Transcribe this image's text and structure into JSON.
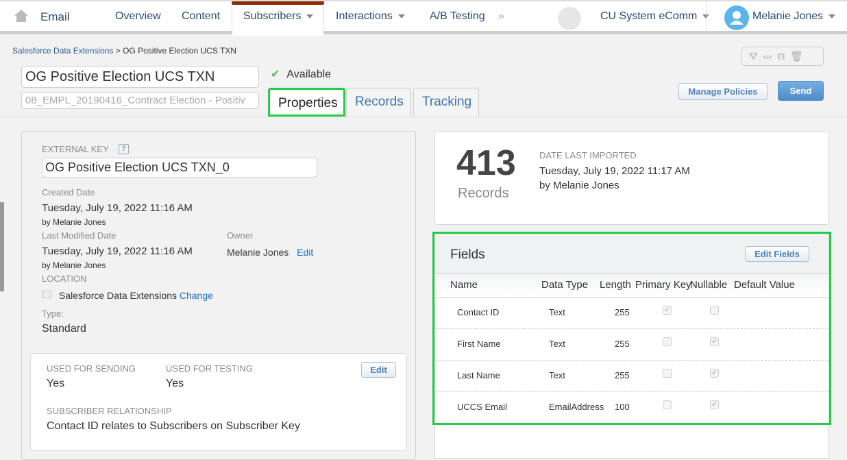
{
  "nav": {
    "home_icon": "home-icon",
    "app": "Email",
    "items": [
      "Overview",
      "Content",
      "Subscribers",
      "Interactions",
      "A/B Testing"
    ],
    "more": "»",
    "business_unit": "CU System eComm",
    "user": "Melanie Jones"
  },
  "breadcrumb": {
    "root": "Salesforce Data Extensions",
    "sep": ">",
    "current": "OG Positive Election UCS TXN"
  },
  "header": {
    "name": "OG Positive Election UCS TXN",
    "description": "08_EMPL_20190416_Contract Election - Positiv",
    "status": "Available",
    "tabs": [
      "Properties",
      "Records",
      "Tracking"
    ],
    "active_tab": "Properties",
    "manage_policies": "Manage Policies",
    "send": "Send",
    "tool_icons": [
      "filter-icon",
      "compare-icon",
      "copy-icon",
      "trash-icon"
    ]
  },
  "properties": {
    "external_key_label": "EXTERNAL KEY",
    "help": "?",
    "external_key": "OG Positive Election UCS TXN_0",
    "created_label": "Created Date",
    "created": "Tuesday, July 19, 2022 11:16 AM",
    "created_by": "by Melanie Jones",
    "modified_label": "Last Modified Date",
    "modified": "Tuesday, July 19, 2022 11:16 AM",
    "modified_by": "by Melanie Jones",
    "owner_label": "Owner",
    "owner": "Melanie Jones",
    "owner_edit": "Edit",
    "location_label": "LOCATION",
    "location": "Salesforce Data Extensions",
    "location_change": "Change",
    "type_label": "Type:",
    "type": "Standard"
  },
  "usage": {
    "sending_label": "USED FOR SENDING",
    "sending": "Yes",
    "testing_label": "USED FOR TESTING",
    "testing": "Yes",
    "edit": "Edit",
    "relationship_label": "SUBSCRIBER RELATIONSHIP",
    "relationship": "Contact ID relates to Subscribers on Subscriber Key"
  },
  "records": {
    "count": "413",
    "label": "Records",
    "imported_label": "DATE LAST IMPORTED",
    "imported": "Tuesday, July 19, 2022 11:17 AM",
    "imported_by": "by Melanie Jones"
  },
  "fields": {
    "title": "Fields",
    "edit": "Edit Fields",
    "columns": [
      "Name",
      "Data Type",
      "Length",
      "Primary Key",
      "Nullable",
      "Default Value"
    ],
    "rows": [
      {
        "name": "Contact ID",
        "type": "Text",
        "length": "255",
        "primary": true,
        "nullable": false
      },
      {
        "name": "First Name",
        "type": "Text",
        "length": "255",
        "primary": false,
        "nullable": true
      },
      {
        "name": "Last Name",
        "type": "Text",
        "length": "255",
        "primary": false,
        "nullable": true
      },
      {
        "name": "UCCS Email",
        "type": "EmailAddress",
        "length": "100",
        "primary": false,
        "nullable": true
      }
    ]
  },
  "highlight_color": "#22cc44"
}
